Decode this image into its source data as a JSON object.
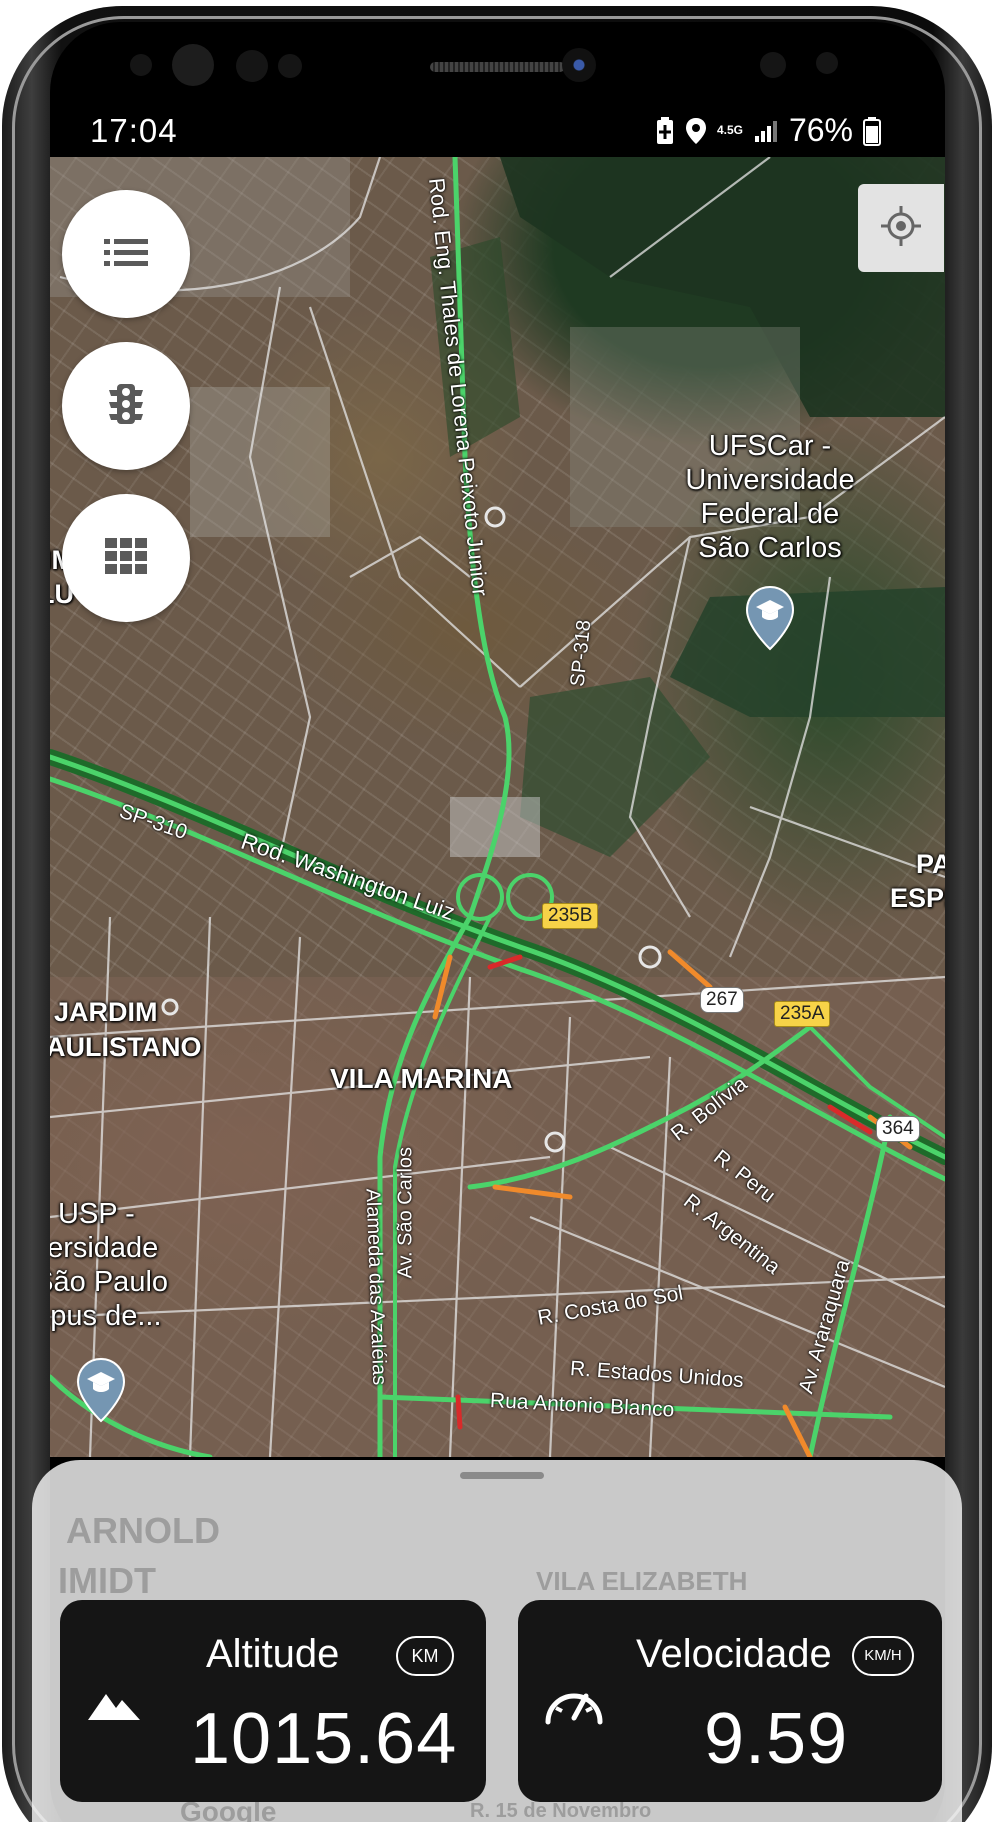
{
  "status_bar": {
    "time": "17:04",
    "network": "4.5G",
    "battery": "76%"
  },
  "map": {
    "place_labels": {
      "jardim": "JARDIM",
      "paulistano": "PAULISTANO",
      "vila_marina": "VILA MARINA",
      "left_edge_1": "IM",
      "left_edge_2": "LU",
      "right_edge_1": "PAI",
      "right_edge_2": "ESPR"
    },
    "poi": {
      "ufscar": [
        "UFSCar -",
        "Universidade",
        "Federal de",
        "São Carlos"
      ],
      "usp": [
        "USP -",
        "niversidade",
        "e São Paulo",
        "ampus de..."
      ]
    },
    "streets": {
      "rod_eng": "Rod. Eng. Thales de Lorena Peixoto Junior",
      "sp318": "SP-318",
      "sp310": "SP-310",
      "washington": "Rod. Washington Luiz",
      "bolivia": "R. Bolívia",
      "peru": "R. Peru",
      "argentina": "R. Argentina",
      "araraquara": "Av. Araraquara",
      "costa_do_sol": "R. Costa do Sol",
      "estados_unidos": "R. Estados Unidos",
      "antonio_blanco": "Rua Antonio Blanco",
      "azaleias": "Alameda das Azaléias",
      "sao_carlos": "Av. São Carlos"
    },
    "shields": {
      "s235b": "235B",
      "s267": "267",
      "s235a": "235A",
      "s364": "364"
    },
    "ghost_labels": {
      "arnold": "ARNOLD",
      "imidt": "IMIDT",
      "vila_elizabeth": "VILA ELIZABETH",
      "google": "Google",
      "novembro": "R. 15 de Novembro"
    }
  },
  "cards": {
    "altitude": {
      "title": "Altitude",
      "unit": "KM",
      "value": "1015.64"
    },
    "velocidade": {
      "title": "Velocidade",
      "unit": "KM/H",
      "value": "9.59"
    }
  },
  "colors": {
    "traffic_green": "#4bd36a",
    "traffic_orange": "#f08a2b",
    "traffic_red": "#d92a2a",
    "card_bg": "#151515",
    "fab_icon": "#5a5a5a"
  }
}
